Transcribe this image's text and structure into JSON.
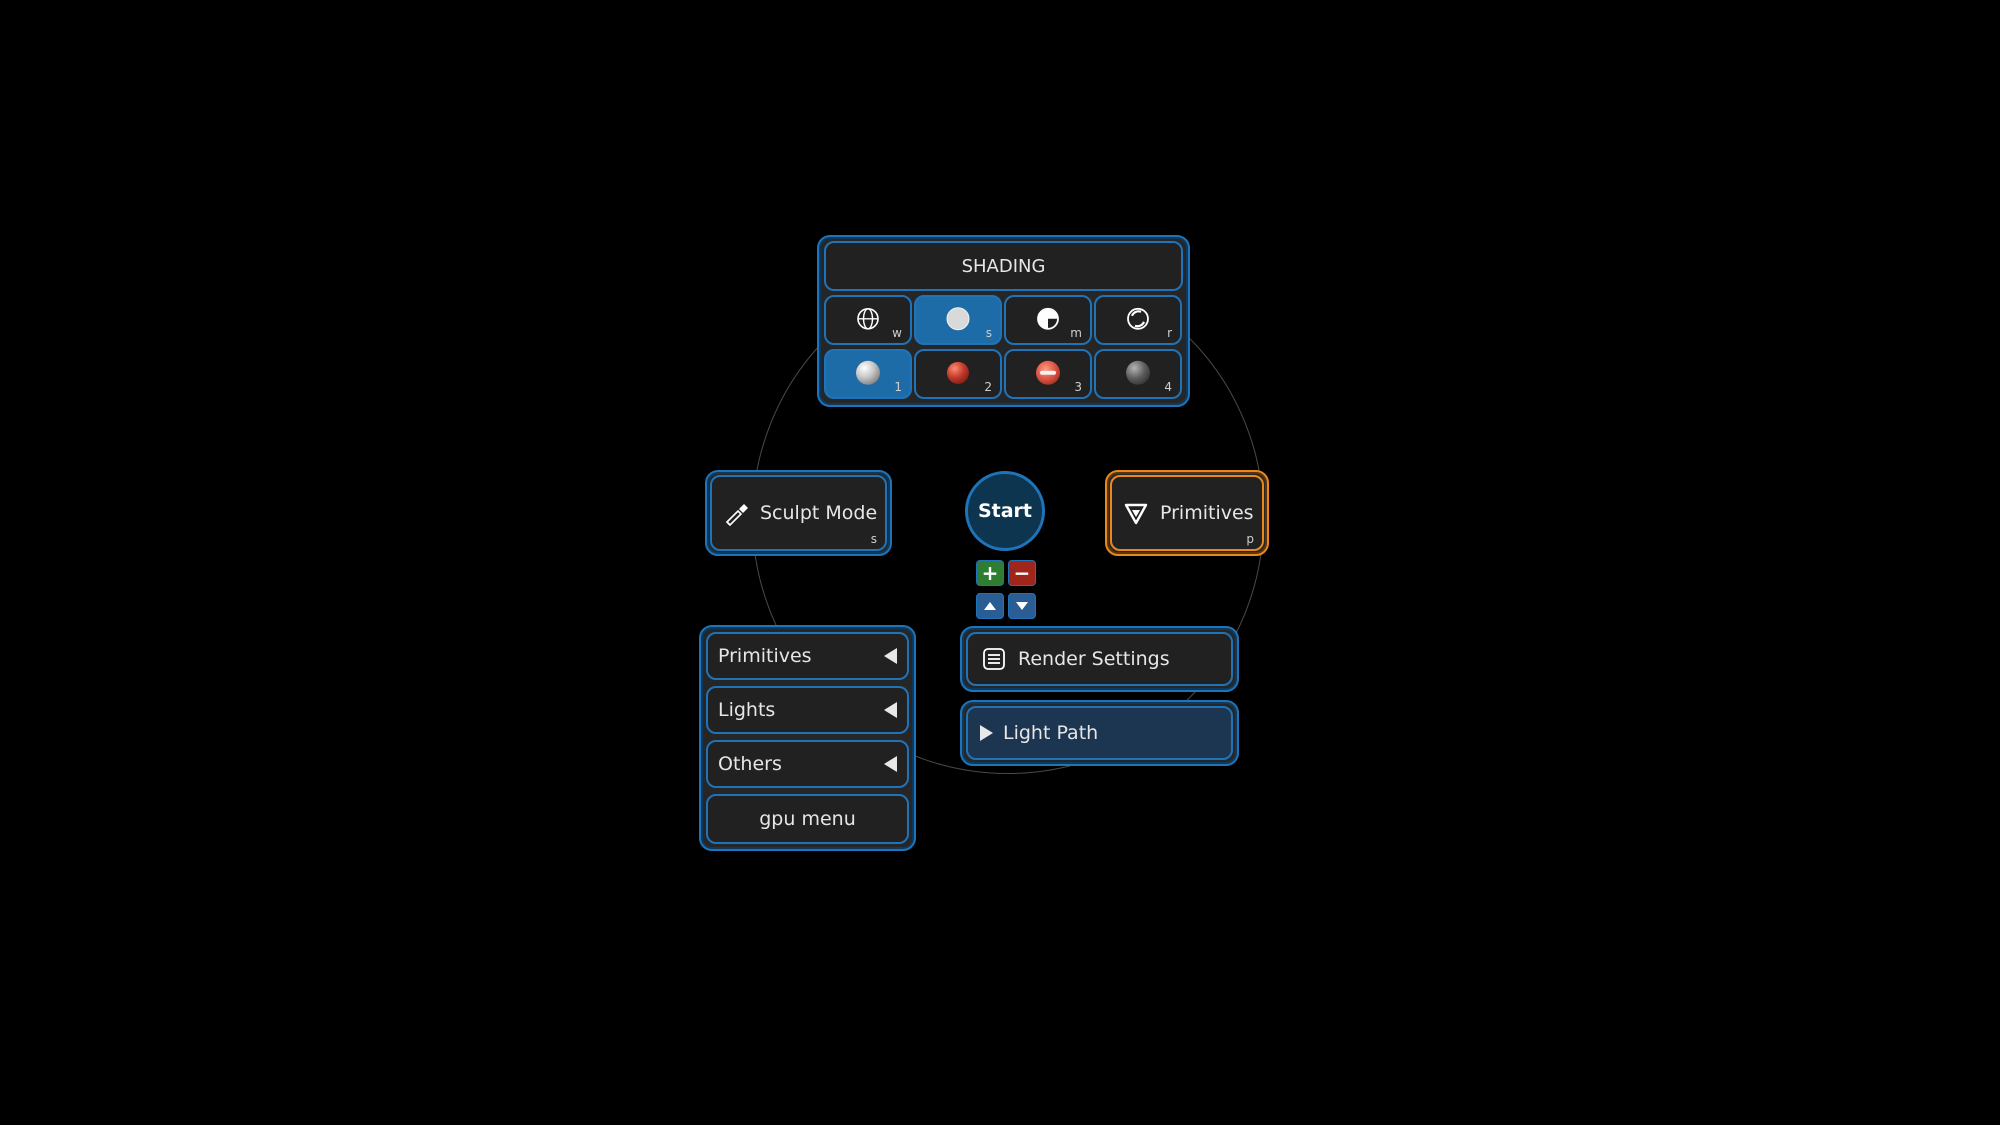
{
  "shading": {
    "title": "SHADING",
    "modes": [
      {
        "icon": "wireframe-icon",
        "key": "w",
        "active": false
      },
      {
        "icon": "solid-icon",
        "key": "s",
        "active": true
      },
      {
        "icon": "material-icon",
        "key": "m",
        "active": false
      },
      {
        "icon": "rendered-icon",
        "key": "r",
        "active": false
      }
    ],
    "materials": [
      {
        "key": "1",
        "color": "#c9c9c9",
        "active": true
      },
      {
        "key": "2",
        "color": "#c0392b",
        "active": false
      },
      {
        "key": "3",
        "color": "#d9503f",
        "active": false
      },
      {
        "key": "4",
        "color": "#5e5e5e",
        "active": false
      }
    ]
  },
  "sculpt": {
    "label": "Sculpt Mode",
    "key": "s",
    "icon": "sculpt-brush-icon"
  },
  "start": {
    "label": "Start"
  },
  "primitives_right": {
    "label": "Primitives",
    "key": "p",
    "icon": "primitive-cone-icon",
    "border_color": "#e8891c"
  },
  "mini_buttons": {
    "plus": "+",
    "minus": "−",
    "up_icon": "arrow-up-icon",
    "down_icon": "arrow-down-icon"
  },
  "list_menu": {
    "items": [
      {
        "label": "Primitives",
        "icon": "chevron-left-icon"
      },
      {
        "label": "Lights",
        "icon": "chevron-left-icon"
      },
      {
        "label": "Others",
        "icon": "chevron-left-icon"
      }
    ],
    "gpu": "gpu menu"
  },
  "render_settings": {
    "label": "Render Settings",
    "icon": "list-icon"
  },
  "light_path": {
    "label": "Light Path",
    "icon": "expand-triangle-icon"
  }
}
